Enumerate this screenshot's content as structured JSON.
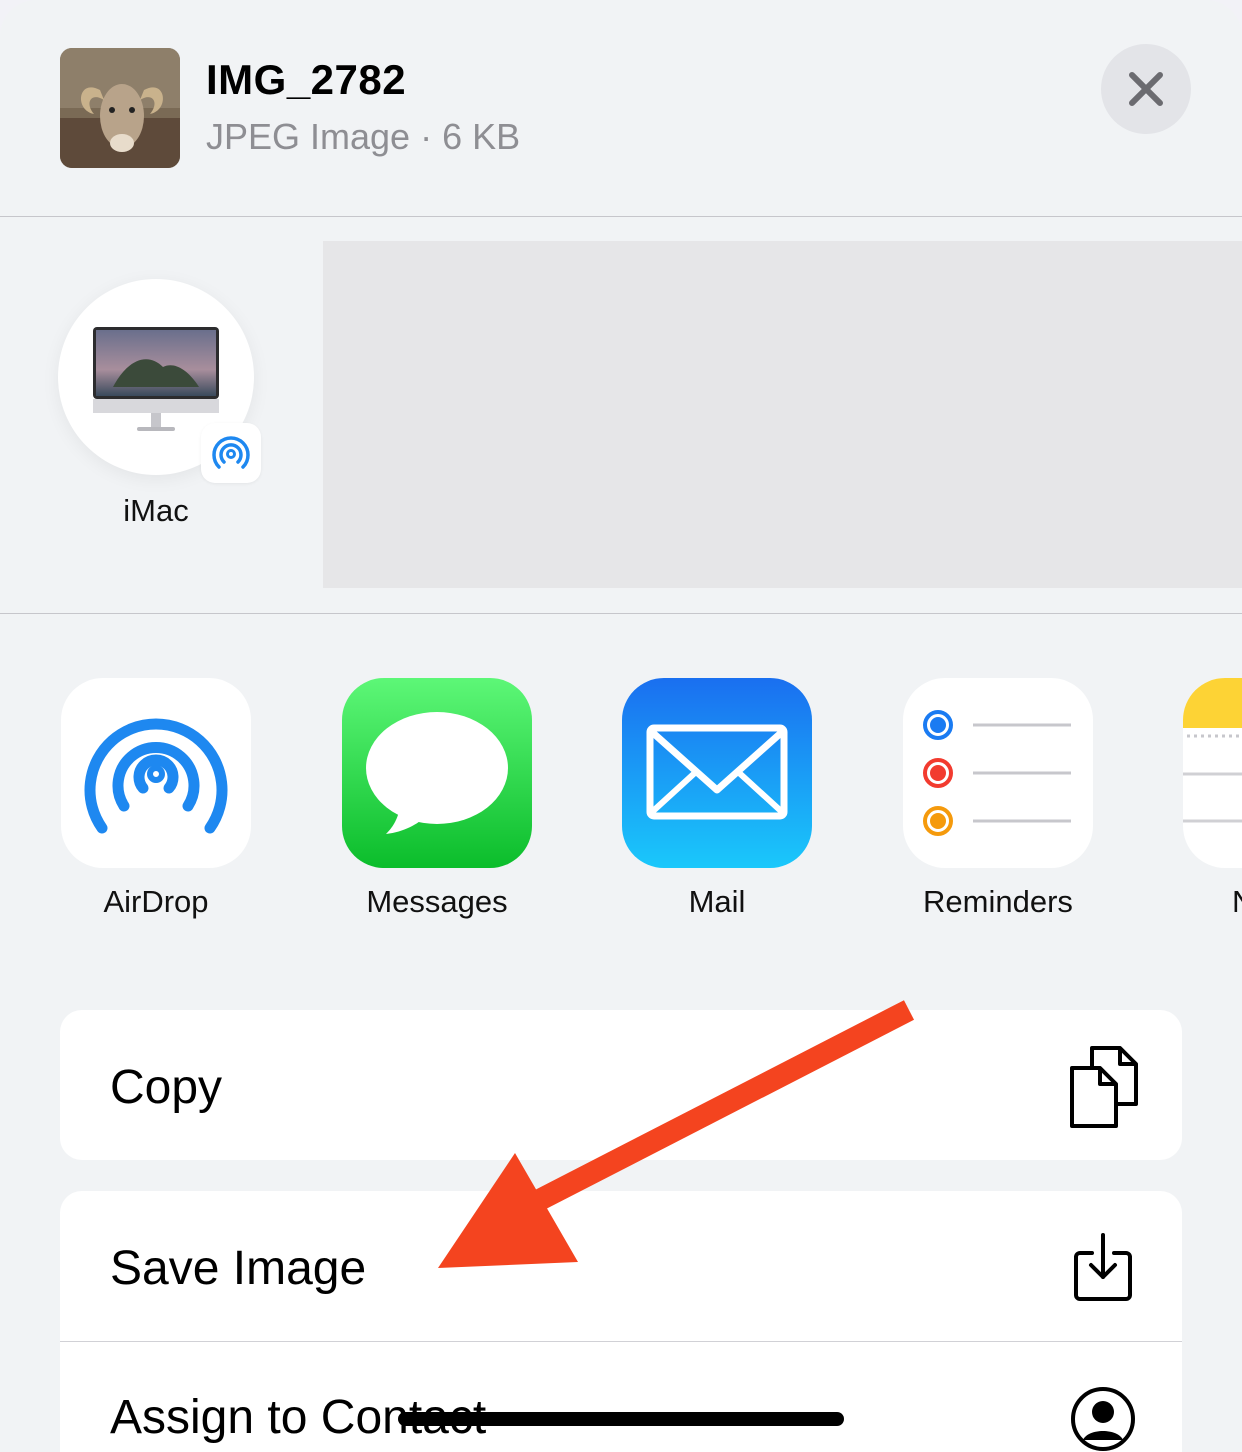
{
  "header": {
    "file_name": "IMG_2782",
    "file_meta": "JPEG Image · 6 KB",
    "thumbnail_icon": "ram-photo-thumbnail",
    "close_icon": "close-icon"
  },
  "people": {
    "devices": [
      {
        "label": "iMac",
        "icon": "imac-icon",
        "badge": "airdrop-icon"
      }
    ]
  },
  "apps": [
    {
      "label": "AirDrop",
      "icon": "airdrop-icon"
    },
    {
      "label": "Messages",
      "icon": "messages-icon"
    },
    {
      "label": "Mail",
      "icon": "mail-icon"
    },
    {
      "label": "Reminders",
      "icon": "reminders-icon"
    },
    {
      "label": "N",
      "icon": "notes-icon"
    }
  ],
  "actions": [
    {
      "label": "Copy",
      "icon": "copy-icon"
    },
    {
      "label": "Save Image",
      "icon": "save-icon"
    },
    {
      "label": "Assign to Contact",
      "icon": "contact-icon"
    }
  ],
  "colors": {
    "annotation_arrow": "#f4441f",
    "sheet_bg": "#f1f3f5",
    "secondary_text": "#8e8e93"
  }
}
